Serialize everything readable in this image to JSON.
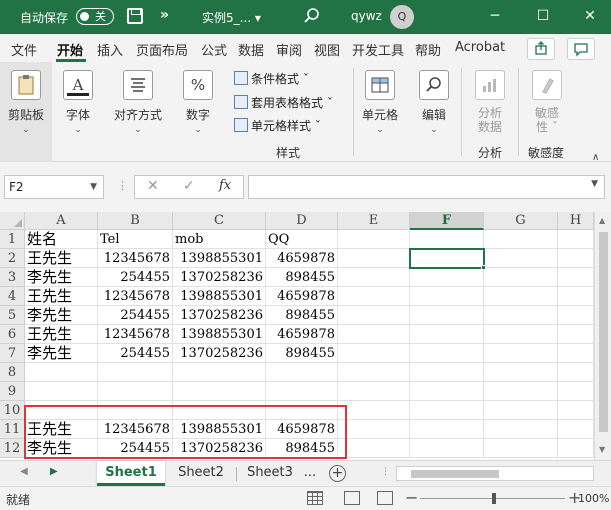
{
  "titlebar": {
    "autosave_label": "自动保存",
    "autosave_state": "关",
    "doc_title": "实例5_...  ▾",
    "user": "qywz",
    "avatar_initial": "Q",
    "minimize": "─",
    "restore": "☐",
    "close": "✕",
    "more": "»"
  },
  "tabs": [
    "文件",
    "开始",
    "插入",
    "页面布局",
    "公式",
    "数据",
    "审阅",
    "视图",
    "开发工具",
    "帮助",
    "Acrobat"
  ],
  "ribbon": {
    "clipboard": "剪贴板",
    "font": "字体",
    "align": "对齐方式",
    "number": "数字",
    "cond_format": "条件格式 ˇ",
    "table_format": "套用表格格式 ˇ",
    "cell_style": "单元格样式 ˇ",
    "styles_group": "样式",
    "cells": "单元格",
    "edit": "编辑",
    "analyze_line1": "分析",
    "analyze_line2": "数据",
    "analyze_group": "分析",
    "sensitivity_line1": "敏感",
    "sensitivity_line2": "性 ˇ",
    "sensitivity_group": "敏感度",
    "arrow": "⌄"
  },
  "formula_bar": {
    "name_box": "F2",
    "cancel": "✕",
    "enter": "✓",
    "fx": "fx",
    "value": ""
  },
  "columns": [
    "A",
    "B",
    "C",
    "D",
    "E",
    "F",
    "G",
    "H"
  ],
  "rows": [
    {
      "num": "1",
      "a": "姓名",
      "b": "Tel",
      "c": "mob",
      "d": "QQ"
    },
    {
      "num": "2",
      "a": "王先生",
      "b": "12345678",
      "c": "1398855301",
      "d": "4659878"
    },
    {
      "num": "3",
      "a": "李先生",
      "b": "254455",
      "c": "1370258236",
      "d": "898455"
    },
    {
      "num": "4",
      "a": "王先生",
      "b": "12345678",
      "c": "1398855301",
      "d": "4659878"
    },
    {
      "num": "5",
      "a": "李先生",
      "b": "254455",
      "c": "1370258236",
      "d": "898455"
    },
    {
      "num": "6",
      "a": "王先生",
      "b": "12345678",
      "c": "1398855301",
      "d": "4659878"
    },
    {
      "num": "7",
      "a": "李先生",
      "b": "254455",
      "c": "1370258236",
      "d": "898455"
    },
    {
      "num": "8",
      "a": "",
      "b": "",
      "c": "",
      "d": ""
    },
    {
      "num": "9",
      "a": "",
      "b": "",
      "c": "",
      "d": ""
    },
    {
      "num": "10",
      "a": "",
      "b": "",
      "c": "",
      "d": ""
    },
    {
      "num": "11",
      "a": "王先生",
      "b": "12345678",
      "c": "1398855301",
      "d": "4659878"
    },
    {
      "num": "12",
      "a": "李先生",
      "b": "254455",
      "c": "1370258236",
      "d": "898455"
    }
  ],
  "active_cell": "F2",
  "sheets": [
    "Sheet1",
    "Sheet2",
    "Sheet3",
    "..."
  ],
  "active_sheet": "Sheet1",
  "add_sheet": "+",
  "status": {
    "mode": "就绪",
    "zoom": "100%",
    "zoom_minus": "−",
    "zoom_plus": "+"
  },
  "colors": {
    "brand": "#217346",
    "highlight_box": "#e0343c"
  }
}
